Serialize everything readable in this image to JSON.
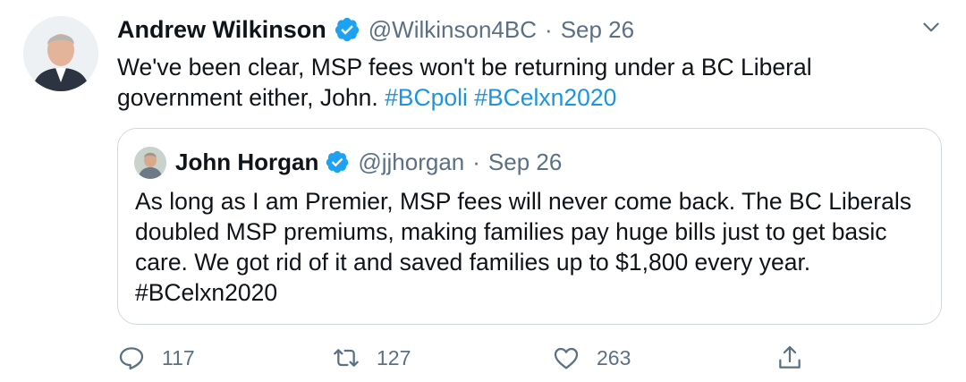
{
  "author": {
    "name": "Andrew Wilkinson",
    "handle": "@Wilkinson4BC",
    "separator": "·",
    "date": "Sep 26"
  },
  "tweet": {
    "text_plain": "We've been clear, MSP fees won't be returning under a BC Liberal government either, John.",
    "hashtag1": "#BCpoli",
    "hashtag2": "#BCelxn2020"
  },
  "quoted": {
    "name": "John Horgan",
    "handle": "@jjhorgan",
    "separator": "·",
    "date": "Sep 26",
    "text_plain": "As long as I am Premier, MSP fees will never come back. The BC Liberals doubled MSP premiums, making families pay huge bills just to get basic care. We got rid of it and saved families up to $1,800 every year.",
    "hashtag": "#BCelxn2020"
  },
  "actions": {
    "reply_count": "117",
    "retweet_count": "127",
    "like_count": "263"
  },
  "colors": {
    "accent": "#1b95e0",
    "verified": "#1da1f2",
    "muted": "#5b7083",
    "border": "#cfd9de"
  },
  "icons": [
    "verified-badge-icon",
    "more-icon",
    "reply-icon",
    "retweet-icon",
    "like-icon",
    "share-icon"
  ]
}
